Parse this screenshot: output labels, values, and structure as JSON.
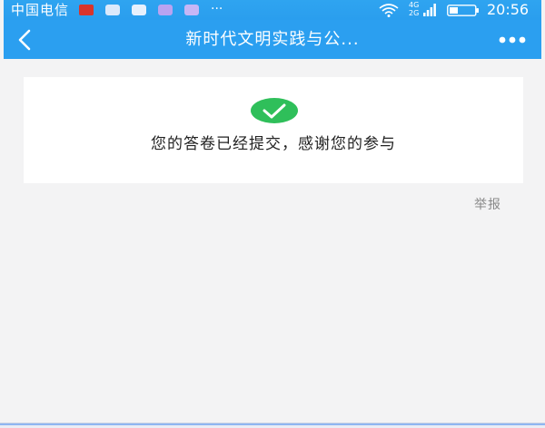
{
  "status_bar": {
    "carrier": "中国电信",
    "more": "···",
    "network_type": "4G 2G",
    "time": "20:56"
  },
  "nav": {
    "title": "新时代文明实践与公...",
    "back_icon": "chevron-left-icon",
    "more_icon": "more-horizontal-icon"
  },
  "result": {
    "icon": "check-icon",
    "message": "您的答卷已经提交，感谢您的参与"
  },
  "footer": {
    "report_label": "举报"
  },
  "colors": {
    "header": "#2b9ff0",
    "success": "#2fbf5a",
    "background": "#f3f3f4",
    "card": "#ffffff"
  }
}
